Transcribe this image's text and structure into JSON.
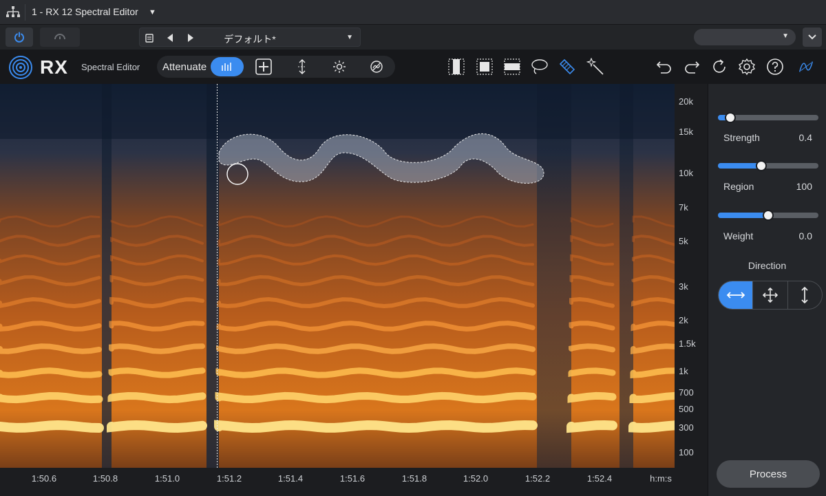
{
  "host": {
    "instance_title": "1 - RX 12 Spectral Editor",
    "preset_name": "デフォルト*"
  },
  "toolbar": {
    "brand": "RX",
    "module_name": "Spectral Editor",
    "mode_label": "Attenuate"
  },
  "spectrogram": {
    "frequency_labels": [
      "20k",
      "15k",
      "10k",
      "7k",
      "5k",
      "3k",
      "2k",
      "1.5k",
      "1k",
      "700",
      "500",
      "300",
      "100"
    ],
    "time_labels": [
      "1:50.6",
      "1:50.8",
      "1:51.0",
      "1:51.2",
      "1:51.4",
      "1:51.6",
      "1:51.8",
      "1:52.0",
      "1:52.2",
      "1:52.4"
    ],
    "time_unit": "h:m:s"
  },
  "panel": {
    "strength": {
      "label": "Strength",
      "value": "0.4",
      "fraction": 0.12
    },
    "region": {
      "label": "Region",
      "value": "100",
      "fraction": 0.43
    },
    "weight": {
      "label": "Weight",
      "value": "0.0",
      "fraction": 0.5
    },
    "direction_label": "Direction",
    "direction_selected": "horizontal",
    "process_label": "Process"
  },
  "colors": {
    "accent": "#3b8cf0",
    "spectro_hot": "#ffb347",
    "spectro_cold": "#17283f"
  }
}
